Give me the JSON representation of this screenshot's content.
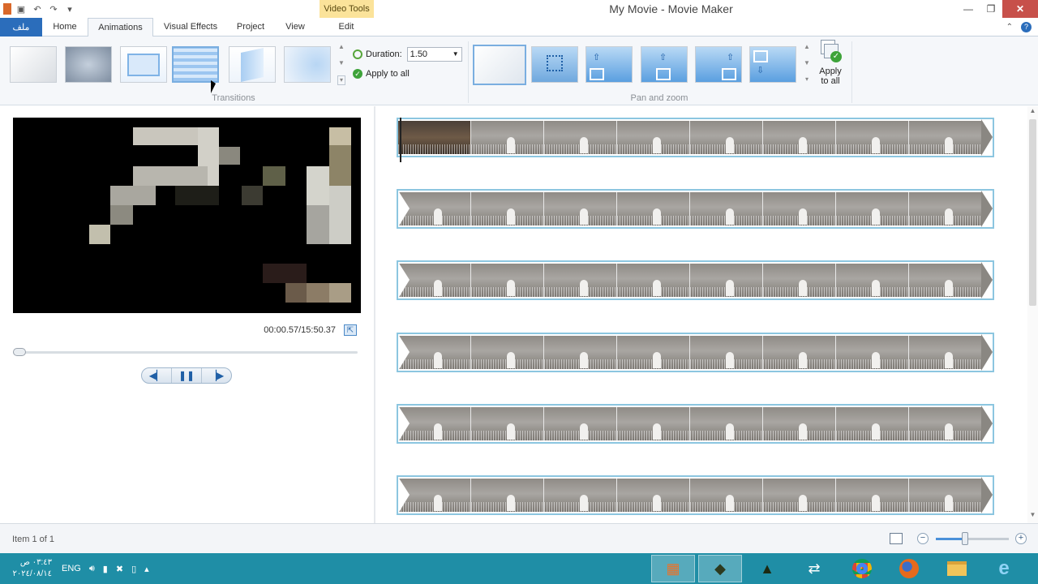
{
  "window": {
    "title": "My Movie - Movie Maker",
    "context_tab": "Video Tools",
    "controls": {
      "minimize": "—",
      "restore": "❐",
      "close": "✕"
    }
  },
  "quick_access": [
    "save-icon",
    "undo-icon",
    "redo-icon",
    "customize-icon"
  ],
  "tabs": {
    "file": "ملف",
    "items": [
      {
        "label": "Home"
      },
      {
        "label": "Animations"
      },
      {
        "label": "Visual Effects"
      },
      {
        "label": "Project"
      },
      {
        "label": "View"
      },
      {
        "label": "Edit"
      }
    ],
    "active": "Animations"
  },
  "ribbon": {
    "transitions": {
      "group_label": "Transitions",
      "duration_label": "Duration:",
      "duration_value": "1.50",
      "apply_all": "Apply to all",
      "selected_index": 3
    },
    "pan_zoom": {
      "group_label": "Pan and zoom",
      "apply_all_line1": "Apply",
      "apply_all_line2": "to all"
    }
  },
  "preview": {
    "timecode": "00:00.57/15:50.37",
    "position_fraction": 0.001,
    "controls": [
      "previous-frame",
      "pause",
      "next-frame"
    ]
  },
  "storyboard": {
    "clip_rows": 6,
    "frames_per_row": 8
  },
  "status": {
    "item_text": "Item 1 of 1",
    "zoom_fraction": 0.4
  },
  "taskbar": {
    "clock_time": "٠٣:٤٣ ص",
    "clock_date": "٢٠٢٤/٠٨/١٤",
    "language": "ENG",
    "apps": [
      "movie-maker",
      "game-app",
      "monitor-app",
      "teamviewer",
      "chrome",
      "firefox",
      "file-explorer",
      "internet-explorer"
    ]
  },
  "colors": {
    "file_tab": "#2b6dbb",
    "context_tab": "#fbe39a",
    "taskbar": "#1f8ea6",
    "clip_border": "#8cc6e0"
  }
}
